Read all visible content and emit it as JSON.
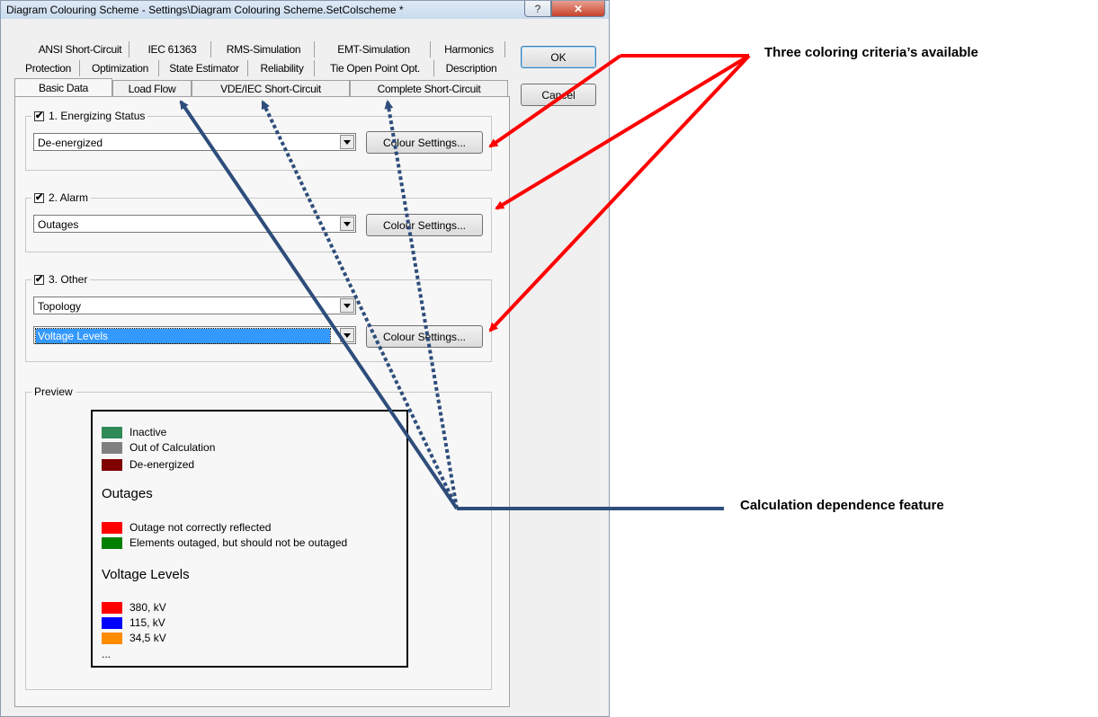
{
  "window": {
    "title": "Diagram Colouring Scheme - Settings\\Diagram Colouring Scheme.SetColscheme *",
    "help_glyph": "?",
    "close_glyph": "✕"
  },
  "tabs": {
    "row1": [
      "ANSI Short-Circuit",
      "IEC 61363",
      "RMS-Simulation",
      "EMT-Simulation",
      "Harmonics"
    ],
    "row2": [
      "Protection",
      "Optimization",
      "State Estimator",
      "Reliability",
      "Tie Open Point Opt.",
      "Description"
    ],
    "row3": [
      "Basic Data",
      "Load Flow",
      "VDE/IEC Short-Circuit",
      "Complete Short-Circuit"
    ]
  },
  "buttons": {
    "ok": "OK",
    "cancel": "Cancel"
  },
  "groups": {
    "energizing": {
      "label": "1. Energizing Status",
      "checked": "✔",
      "value": "De-energized",
      "button": "Colour Settings..."
    },
    "alarm": {
      "label": "2. Alarm",
      "checked": "✔",
      "value": "Outages",
      "button": "Colour Settings..."
    },
    "other": {
      "label": "3. Other",
      "checked": "✔",
      "value1": "Topology",
      "value2": "Voltage Levels",
      "button": "Colour Settings..."
    }
  },
  "preview": {
    "label": "Preview",
    "status_items": [
      {
        "label": "Inactive",
        "color": "#2e8b57"
      },
      {
        "label": "Out of Calculation",
        "color": "#808080"
      },
      {
        "label": "De-energized",
        "color": "#800000"
      }
    ],
    "outages_heading": "Outages",
    "outage_items": [
      {
        "label": "Outage not correctly reflected",
        "color": "#ff0000"
      },
      {
        "label": "Elements outaged, but should not be outaged",
        "color": "#008000"
      }
    ],
    "voltage_heading": "Voltage Levels",
    "voltage_items": [
      {
        "label": "380, kV",
        "color": "#ff0000"
      },
      {
        "label": "115, kV",
        "color": "#0000ff"
      },
      {
        "label": "34,5 kV",
        "color": "#ff8c00"
      }
    ],
    "more": "..."
  },
  "annotations": {
    "coloring_criteria": "Three coloring criteria’s available",
    "calc_dependence": "Calculation dependence feature",
    "red_arrow_color": "#ff0000",
    "blue_line_color": "#2e4d7b"
  }
}
